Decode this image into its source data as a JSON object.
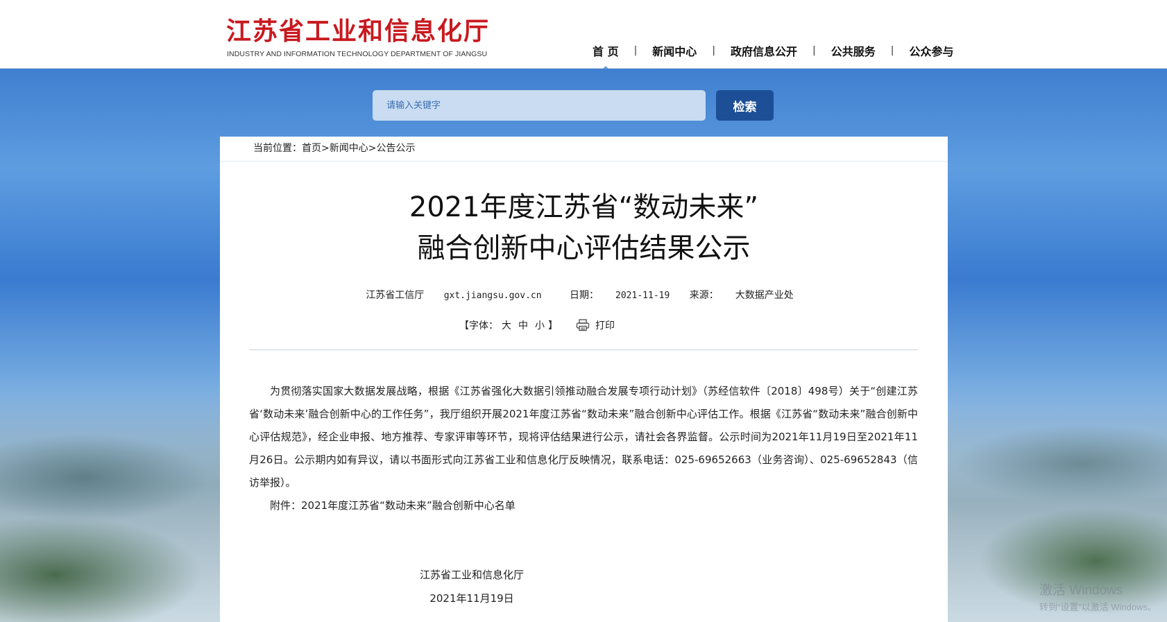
{
  "header": {
    "logo_cn": "江苏省工业和信息化厅",
    "logo_en": "INDUSTRY AND INFORMATION TECHNOLOGY DEPARTMENT OF JIANGSU",
    "nav": [
      "首 页",
      "新闻中心",
      "政府信息公开",
      "公共服务",
      "公众参与"
    ],
    "nav_separator": "|"
  },
  "search": {
    "placeholder": "请输入关键字",
    "button_label": "检索"
  },
  "breadcrumb": {
    "prefix": "当前位置：",
    "items": [
      "首页",
      "新闻中心",
      "公告公示"
    ],
    "separator": ">"
  },
  "article": {
    "title_line1": "2021年度江苏省“数动未来”",
    "title_line2": "融合创新中心评估结果公示",
    "meta": {
      "publisher": "江苏省工信厅",
      "site": "gxt.jiangsu.gov.cn",
      "date_label": "日期：",
      "date": "2021-11-19",
      "source_label": "来源：",
      "source": "大数据产业处"
    },
    "font_size": {
      "open": "【字体：",
      "large": "大",
      "medium": "中",
      "small": "小",
      "close": "】"
    },
    "print_label": "打印",
    "paragraph1": "为贯彻落实国家大数据发展战略，根据《江苏省强化大数据引领推动融合发展专项行动计划》（苏经信软件〔2018〕498号）关于“创建江苏省‘数动未来’融合创新中心的工作任务”，我厅组织开展2021年度江苏省“数动未来”融合创新中心评估工作。根据《江苏省“数动未来”融合创新中心评估规范》，经企业申报、地方推荐、专家评审等环节，现将评估结果进行公示，请社会各界监督。公示时间为2021年11月19日至2021年11月26日。公示期内如有异议，请以书面形式向江苏省工业和信息化厅反映情况，联系电话：025-69652663（业务咨询）、025-69652843（信访举报）。",
    "attachment": "附件：2021年度江苏省“数动未来”融合创新中心名单",
    "signature_org": "江苏省工业和信息化厅",
    "signature_date": "2021年11月19日"
  },
  "watermark": {
    "line1": "激活 Windows",
    "line2": "转到“设置”以激活 Windows。"
  },
  "colors": {
    "logo_red": "#c8191f",
    "search_button": "#1d4f96",
    "search_field": "#c9dcf2"
  }
}
